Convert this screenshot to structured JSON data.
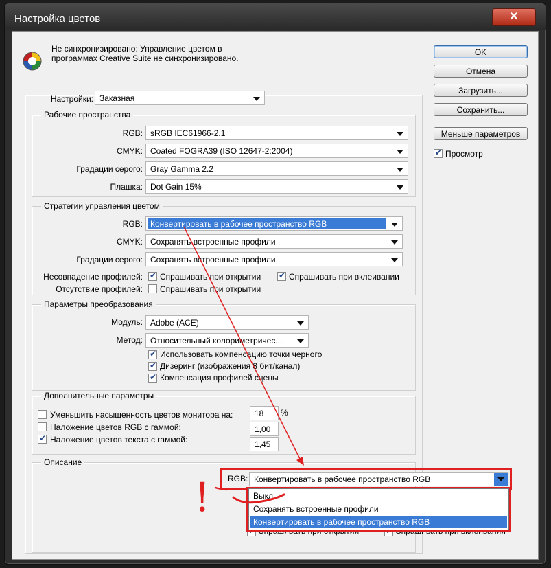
{
  "window": {
    "title": "Настройка цветов",
    "close_glyph": "✕"
  },
  "sync_message": {
    "line1": "Не синхронизировано: Управление цветом в",
    "line2": "программах Creative Suite не синхронизировано."
  },
  "settings": {
    "label": "Настройки:",
    "value": "Заказная"
  },
  "working_spaces": {
    "title": "Рабочие пространства",
    "rows": [
      {
        "label": "RGB:",
        "value": "sRGB IEC61966-2.1"
      },
      {
        "label": "CMYK:",
        "value": "Coated FOGRA39 (ISO 12647-2:2004)"
      },
      {
        "label": "Градации серого:",
        "value": "Gray Gamma 2.2"
      },
      {
        "label": "Плашка:",
        "value": "Dot Gain 15%"
      }
    ]
  },
  "policies": {
    "title": "Стратегии управления цветом",
    "rows": [
      {
        "label": "RGB:",
        "value": "Конвертировать в рабочее пространство RGB"
      },
      {
        "label": "CMYK:",
        "value": "Сохранять встроенные профили"
      },
      {
        "label": "Градации серого:",
        "value": "Сохранять встроенные профили"
      }
    ],
    "mismatch_label": "Несовпадение профилей:",
    "mismatch_open": "Спрашивать при открытии",
    "mismatch_paste": "Спрашивать при вклеивании",
    "missing_label": "Отсутствие профилей:",
    "missing_open": "Спрашивать при открытии"
  },
  "conversion": {
    "title": "Параметры преобразования",
    "engine_label": "Модуль:",
    "engine_value": "Adobe (ACE)",
    "intent_label": "Метод:",
    "intent_value": "Относительный колориметричес...",
    "bpc": "Использовать компенсацию точки черного",
    "dither": "Дизеринг (изображения 8 бит/канал)",
    "scene": "Компенсация профилей сцены"
  },
  "advanced": {
    "title": "Дополнительные параметры",
    "desaturate_label": "Уменьшить насыщенность цветов монитора на:",
    "desaturate_value": "18",
    "desaturate_unit": "%",
    "blend_rgb_label": "Наложение цветов RGB с гаммой:",
    "blend_rgb_value": "1,00",
    "blend_text_label": "Наложение цветов текста с гаммой:",
    "blend_text_value": "1,45"
  },
  "description": {
    "title": "Описание"
  },
  "buttons": {
    "ok": "OK",
    "cancel": "Отмена",
    "load": "Загрузить...",
    "save": "Сохранить...",
    "fewer": "Меньше параметров",
    "preview": "Просмотр"
  },
  "callout": {
    "label": "RGB:",
    "value": "Конвертировать в рабочее пространство RGB",
    "options": [
      "Выкл",
      "Сохранять встроенные профили",
      "Конвертировать в рабочее пространство RGB"
    ],
    "behind_open": "Спрашивать при открытии",
    "behind_paste": "Спрашивать при вклеивании",
    "exclamation": "!"
  },
  "colors": {
    "highlight": "#3a7bd5",
    "annotation_red": "#e02020",
    "titlebar": "#2e2e2e"
  },
  "icons": {
    "color_wheel": "color-wheel-icon",
    "dropdown": "chevron-down-icon",
    "check": "checkmark-icon"
  }
}
